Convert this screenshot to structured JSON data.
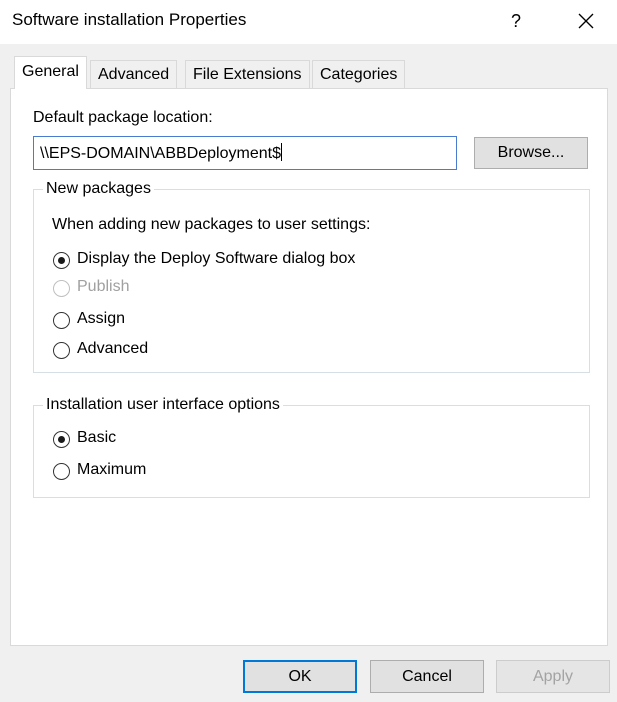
{
  "window": {
    "title": "Software installation Properties",
    "help_glyph": "?",
    "close_icon": "close-icon"
  },
  "tabs": [
    {
      "label": "General",
      "active": true
    },
    {
      "label": "Advanced",
      "active": false
    },
    {
      "label": "File Extensions",
      "active": false
    },
    {
      "label": "Categories",
      "active": false
    }
  ],
  "general": {
    "default_location_label": "Default package location:",
    "default_location_value": "\\\\EPS-DOMAIN\\ABBDeployment$",
    "browse_label": "Browse...",
    "new_packages": {
      "title": "New packages",
      "prompt": "When adding new packages to user settings:",
      "options": [
        {
          "label": "Display the Deploy Software dialog box",
          "selected": true,
          "enabled": true
        },
        {
          "label": "Publish",
          "selected": false,
          "enabled": false
        },
        {
          "label": "Assign",
          "selected": false,
          "enabled": true
        },
        {
          "label": "Advanced",
          "selected": false,
          "enabled": true
        }
      ]
    },
    "ui_options": {
      "title": "Installation user interface options",
      "options": [
        {
          "label": "Basic",
          "selected": true
        },
        {
          "label": "Maximum",
          "selected": false
        }
      ]
    }
  },
  "footer": {
    "ok_label": "OK",
    "cancel_label": "Cancel",
    "apply_label": "Apply",
    "apply_enabled": false
  }
}
